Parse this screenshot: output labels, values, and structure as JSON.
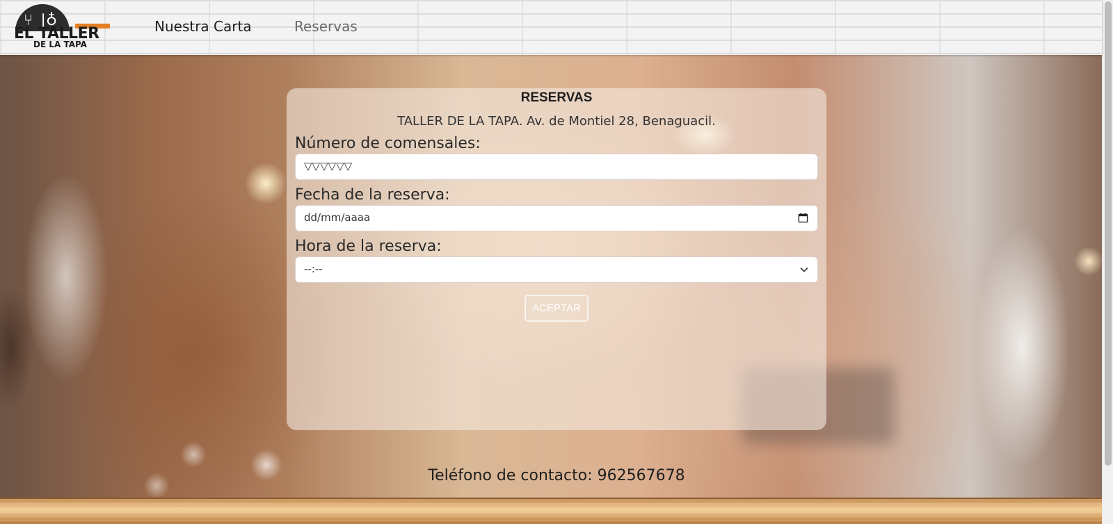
{
  "header": {
    "logo": {
      "main": "EL TALLER",
      "sub": "DE LA TAPA"
    },
    "nav": [
      {
        "label": "Nuestra Carta"
      },
      {
        "label": "Reservas"
      }
    ]
  },
  "form": {
    "title": "RESERVAS",
    "address": "TALLER DE LA TAPA. Av. de Montiel 28, Benaguacil.",
    "diners": {
      "label": "Número de comensales:",
      "value": "▽▽▽▽▽▽"
    },
    "date": {
      "label": "Fecha de la reserva:",
      "placeholder": "dd/mm/aaaa"
    },
    "time": {
      "label": "Hora de la reserva:",
      "value": "--:--"
    },
    "accept_label": "ACEPTAR"
  },
  "footer": {
    "contact": "Teléfono de contacto: 962567678"
  },
  "colors": {
    "logo_accent": "#e67e22",
    "logo_dark": "#1c1c1c",
    "card": "#f5ece4"
  },
  "icons": [
    "fork-icon",
    "knife-icon",
    "spoon-icon",
    "calendar-icon",
    "chevron-down-icon"
  ]
}
